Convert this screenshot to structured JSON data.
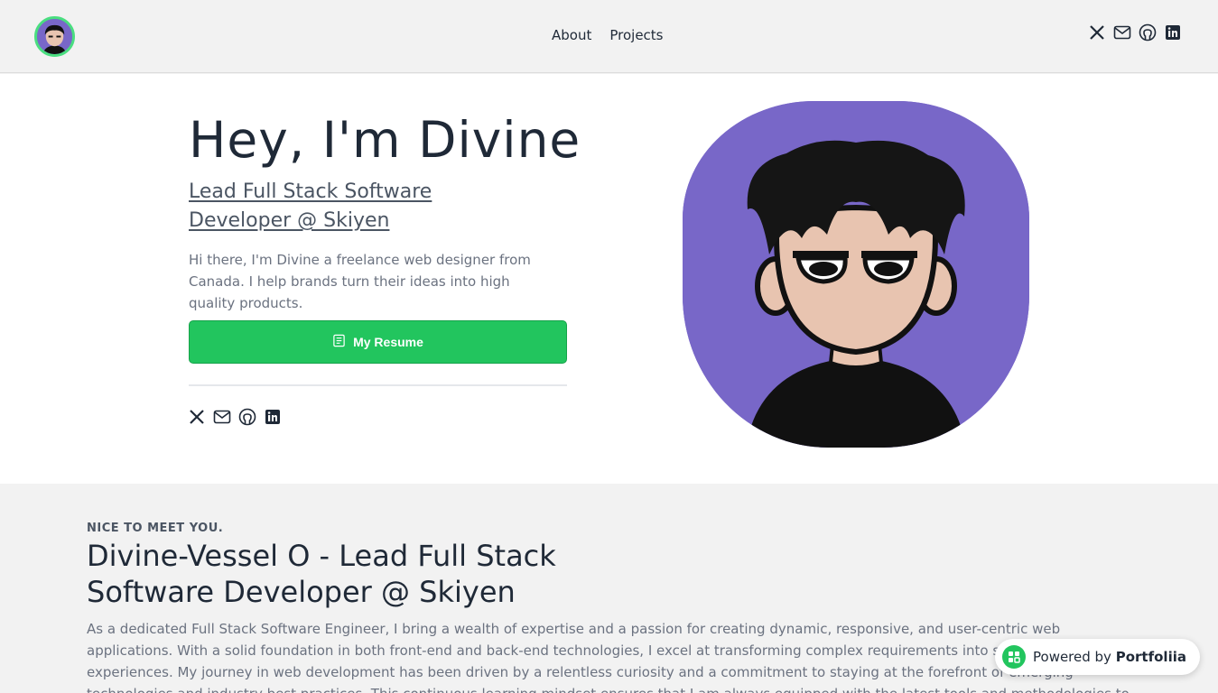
{
  "header": {
    "nav": [
      "About",
      "Projects"
    ],
    "social_icons": [
      "x-icon",
      "mail-icon",
      "github-icon",
      "linkedin-icon"
    ]
  },
  "hero": {
    "title": "Hey, I'm Divine",
    "role": "Lead Full Stack Software Developer @ Skiyen",
    "bio": "Hi there, I'm Divine a freelance web designer from Canada. I help brands turn their ideas into high quality products.",
    "resume_label": "My Resume",
    "social_icons": [
      "x-icon",
      "mail-icon",
      "github-icon",
      "linkedin-icon"
    ]
  },
  "about": {
    "eyebrow": "NICE TO MEET YOU.",
    "title": "Divine-Vessel O - Lead Full Stack Software Developer @ Skiyen",
    "text": "As a dedicated Full Stack Software Engineer, I bring a wealth of expertise and a passion for creating dynamic, responsive, and user-centric web applications. With a solid foundation in both front-end and back-end technologies, I excel at transforming complex requirements into seamless experiences. My journey in web development has been driven by a relentless curiosity and a commitment to staying at the forefront of emerging technologies and industry best practices. This continuous learning mindset ensures that I am always equipped with the latest tools and methodologies to"
  },
  "powered": {
    "prefix": "Powered by",
    "brand": "Portfoliia"
  },
  "colors": {
    "accent": "#22c55e",
    "avatar_bg": "#7867c8"
  }
}
